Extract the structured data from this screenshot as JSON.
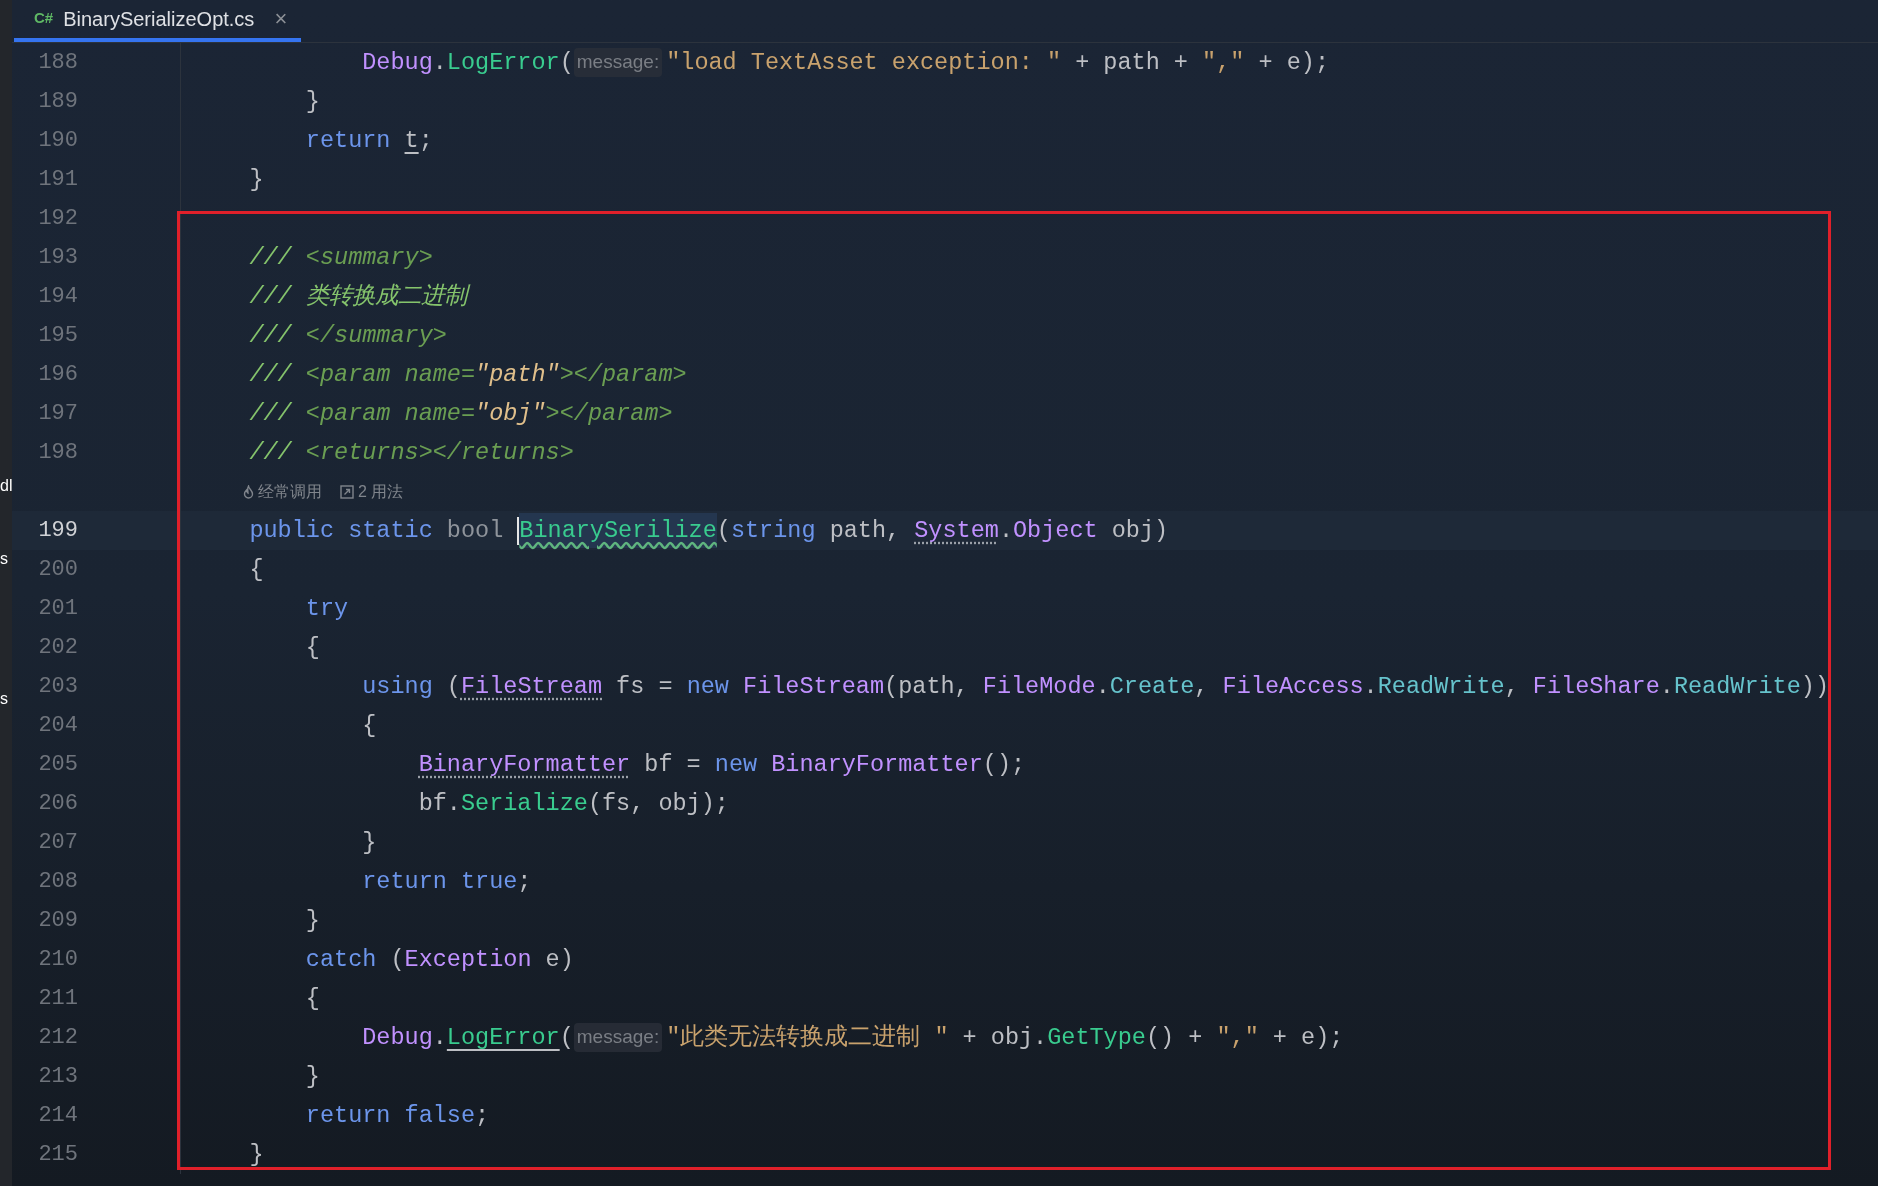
{
  "side_panel_fragments": [
    "dl",
    "s",
    "s"
  ],
  "tab": {
    "language": "C#",
    "filename": "BinarySerializeOpt.cs",
    "close": "×",
    "selected": true
  },
  "lines": [
    {
      "number": "188",
      "tokens": [
        {
          "kind": "type",
          "text": "            Debug"
        },
        {
          "kind": "plain",
          "text": "."
        },
        {
          "kind": "method",
          "text": "LogError"
        },
        {
          "kind": "plain",
          "text": "("
        },
        {
          "kind": "hint",
          "text": "message:"
        },
        {
          "kind": "string",
          "text": "\"load TextAsset exception: \""
        },
        {
          "kind": "plain",
          "text": " + path + "
        },
        {
          "kind": "string",
          "text": "\",\""
        },
        {
          "kind": "plain",
          "text": " + e);"
        }
      ]
    },
    {
      "number": "189",
      "tokens": [
        {
          "kind": "plain",
          "text": "        }"
        }
      ]
    },
    {
      "number": "190",
      "tokens": [
        {
          "kind": "keyword",
          "text": "        return "
        },
        {
          "kind": "plain",
          "text": "t",
          "underlined": true
        },
        {
          "kind": "plain",
          "text": ";"
        }
      ]
    },
    {
      "number": "191",
      "tokens": [
        {
          "kind": "plain",
          "text": "    }"
        }
      ]
    },
    {
      "number": "192"
    },
    {
      "number": "193",
      "tokens": [
        {
          "kind": "comment",
          "text": "    /// "
        },
        {
          "kind": "doc_tag",
          "text": "<summary>"
        }
      ]
    },
    {
      "number": "194",
      "tokens": [
        {
          "kind": "comment",
          "text": "    /// 类转换成二进制"
        }
      ]
    },
    {
      "number": "195",
      "tokens": [
        {
          "kind": "comment",
          "text": "    /// "
        },
        {
          "kind": "doc_tag",
          "text": "</summary>"
        }
      ]
    },
    {
      "number": "196",
      "tokens": [
        {
          "kind": "comment",
          "text": "    /// "
        },
        {
          "kind": "doc_tag",
          "text": "<param name="
        },
        {
          "kind": "doc_value",
          "text": "\"path\""
        },
        {
          "kind": "doc_tag",
          "text": "></param>"
        }
      ]
    },
    {
      "number": "197",
      "tokens": [
        {
          "kind": "comment",
          "text": "    /// "
        },
        {
          "kind": "doc_tag",
          "text": "<param name="
        },
        {
          "kind": "doc_value",
          "text": "\"obj\""
        },
        {
          "kind": "doc_tag",
          "text": "></param>"
        }
      ]
    },
    {
      "number": "198",
      "tokens": [
        {
          "kind": "comment",
          "text": "    /// "
        },
        {
          "kind": "doc_tag",
          "text": "<returns></returns>"
        }
      ]
    },
    {
      "codelens": [
        "经常调用",
        "2 用法"
      ]
    },
    {
      "number": "199",
      "current": true,
      "tokens": [
        {
          "kind": "keyword",
          "text": "    public static "
        },
        {
          "kind": "keyword_dim",
          "text": "bool "
        },
        {
          "kind": "method",
          "text": "BinarySerilize",
          "wavy_underline": true,
          "caret": true,
          "highlight": true
        },
        {
          "kind": "plain",
          "text": "("
        },
        {
          "kind": "keyword",
          "text": "string"
        },
        {
          "kind": "plain",
          "text": " path, "
        },
        {
          "kind": "type",
          "text": "System",
          "dotted_underline": true
        },
        {
          "kind": "plain",
          "text": "."
        },
        {
          "kind": "type",
          "text": "Object"
        },
        {
          "kind": "plain",
          "text": " obj)"
        }
      ]
    },
    {
      "number": "200",
      "tokens": [
        {
          "kind": "plain",
          "text": "    {"
        }
      ]
    },
    {
      "number": "201",
      "tokens": [
        {
          "kind": "keyword",
          "text": "        try"
        }
      ]
    },
    {
      "number": "202",
      "tokens": [
        {
          "kind": "plain",
          "text": "        {"
        }
      ]
    },
    {
      "number": "203",
      "tokens": [
        {
          "kind": "keyword",
          "text": "            using"
        },
        {
          "kind": "plain",
          "text": " ("
        },
        {
          "kind": "type",
          "text": "FileStream",
          "dotted_underline": true
        },
        {
          "kind": "plain",
          "text": " fs = "
        },
        {
          "kind": "keyword",
          "text": "new "
        },
        {
          "kind": "type",
          "text": "FileStream"
        },
        {
          "kind": "plain",
          "text": "(path, "
        },
        {
          "kind": "type",
          "text": "FileMode"
        },
        {
          "kind": "plain",
          "text": "."
        },
        {
          "kind": "member",
          "text": "Create"
        },
        {
          "kind": "plain",
          "text": ", "
        },
        {
          "kind": "type",
          "text": "FileAccess"
        },
        {
          "kind": "plain",
          "text": "."
        },
        {
          "kind": "member",
          "text": "ReadWrite"
        },
        {
          "kind": "plain",
          "text": ", "
        },
        {
          "kind": "type",
          "text": "FileShare"
        },
        {
          "kind": "plain",
          "text": "."
        },
        {
          "kind": "member",
          "text": "ReadWrite"
        },
        {
          "kind": "plain",
          "text": "))"
        }
      ]
    },
    {
      "number": "204",
      "tokens": [
        {
          "kind": "plain",
          "text": "            {"
        }
      ]
    },
    {
      "number": "205",
      "tokens": [
        {
          "kind": "type",
          "text": "                BinaryFormatter",
          "dotted_underline": true
        },
        {
          "kind": "plain",
          "text": " bf = "
        },
        {
          "kind": "keyword",
          "text": "new "
        },
        {
          "kind": "type",
          "text": "BinaryFormatter"
        },
        {
          "kind": "plain",
          "text": "();"
        }
      ]
    },
    {
      "number": "206",
      "tokens": [
        {
          "kind": "plain",
          "text": "                bf."
        },
        {
          "kind": "method",
          "text": "Serialize"
        },
        {
          "kind": "plain",
          "text": "(fs, obj);"
        }
      ]
    },
    {
      "number": "207",
      "tokens": [
        {
          "kind": "plain",
          "text": "            }"
        }
      ]
    },
    {
      "number": "208",
      "tokens": [
        {
          "kind": "keyword",
          "text": "            return true"
        },
        {
          "kind": "plain",
          "text": ";"
        }
      ]
    },
    {
      "number": "209",
      "tokens": [
        {
          "kind": "plain",
          "text": "        }"
        }
      ]
    },
    {
      "number": "210",
      "tokens": [
        {
          "kind": "keyword",
          "text": "        catch"
        },
        {
          "kind": "plain",
          "text": " ("
        },
        {
          "kind": "type",
          "text": "Exception"
        },
        {
          "kind": "plain",
          "text": " e)"
        }
      ]
    },
    {
      "number": "211",
      "tokens": [
        {
          "kind": "plain",
          "text": "        {"
        }
      ]
    },
    {
      "number": "212",
      "tokens": [
        {
          "kind": "type",
          "text": "            Debug"
        },
        {
          "kind": "plain",
          "text": "."
        },
        {
          "kind": "method",
          "text": "LogError",
          "underlined": true
        },
        {
          "kind": "plain",
          "text": "("
        },
        {
          "kind": "hint",
          "text": "message:"
        },
        {
          "kind": "string",
          "text": "\"此类无法转换成二进制 \""
        },
        {
          "kind": "plain",
          "text": " + obj."
        },
        {
          "kind": "method",
          "text": "GetType"
        },
        {
          "kind": "plain",
          "text": "() + "
        },
        {
          "kind": "string",
          "text": "\",\""
        },
        {
          "kind": "plain",
          "text": " + e);"
        }
      ]
    },
    {
      "number": "213",
      "tokens": [
        {
          "kind": "plain",
          "text": "        }"
        }
      ]
    },
    {
      "number": "214",
      "tokens": [
        {
          "kind": "keyword",
          "text": "        return false"
        },
        {
          "kind": "plain",
          "text": ";"
        }
      ]
    },
    {
      "number": "215",
      "tokens": [
        {
          "kind": "plain",
          "text": "    }"
        }
      ]
    }
  ]
}
